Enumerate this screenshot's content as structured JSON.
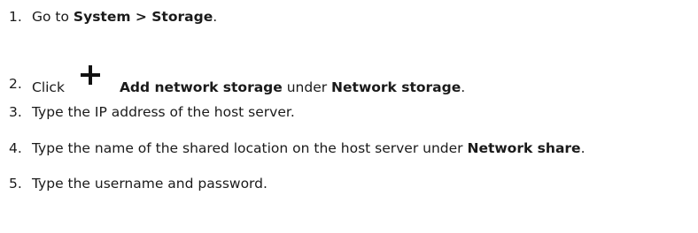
{
  "steps": [
    {
      "number": "1.",
      "parts": [
        "Go to ",
        "System > Storage",
        "."
      ]
    },
    {
      "number": "2.",
      "parts": [
        "Click",
        "Add network storage",
        " under ",
        "Network storage",
        "."
      ],
      "icon": "plus-icon"
    },
    {
      "number": "3.",
      "parts": [
        "Type the IP address of the host server."
      ]
    },
    {
      "number": "4.",
      "parts": [
        "Type the name of the shared location on the host server under ",
        "Network share",
        "."
      ]
    },
    {
      "number": "5.",
      "parts": [
        "Type the username and password."
      ]
    }
  ]
}
